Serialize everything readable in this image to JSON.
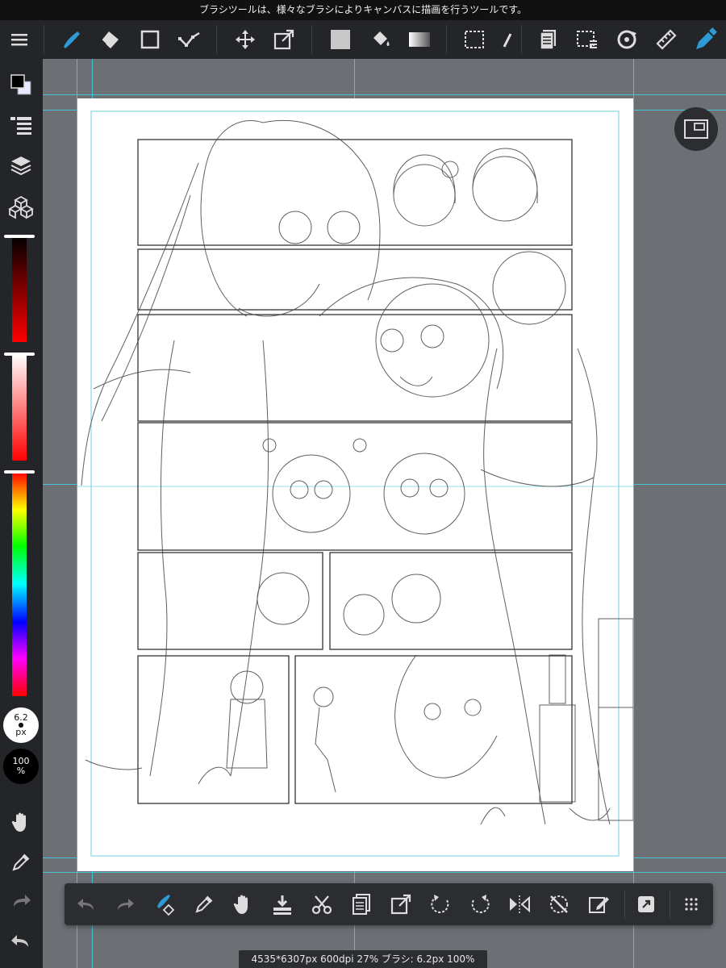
{
  "hint_text": "ブラシツールは、様々なブラシによりキャンバスに描画を行うツールです。",
  "status_text": "4535*6307px 600dpi 27% ブラシ: 6.2px 100%",
  "brush_size": {
    "value": "6.2",
    "unit": "px"
  },
  "brush_opacity": {
    "value": "100",
    "unit": "%"
  },
  "colors": {
    "accent": "#2e9bd6",
    "guide": "#46c1d6",
    "toolbar": "#232528",
    "workspace": "#6c6f74"
  },
  "toolbar_icons": [
    "menu-icon",
    "brush-icon",
    "eraser-icon",
    "rectangle-icon",
    "lasso-line-icon",
    "move-icon",
    "transform-icon",
    "fill-color-icon",
    "bucket-icon",
    "gradient-icon",
    "selection-icon",
    "selection-pen-icon",
    "panel-icon",
    "select-layer-icon",
    "rotate-icon",
    "ruler-icon",
    "active-brush-icon"
  ],
  "sidebar_icons": [
    "color-icon",
    "layer-list-icon",
    "layers-icon",
    "material-icon",
    "hand-icon",
    "eyedropper-icon",
    "redo-icon",
    "undo-icon"
  ],
  "bottom_icons": [
    "undo-icon",
    "redo-icon",
    "brush-clear-icon",
    "eyedropper-icon",
    "hand-icon",
    "import-icon",
    "cut-icon",
    "paste-icon",
    "export-icon",
    "rotate-left-icon",
    "rotate-right-icon",
    "flip-icon",
    "reset-rotation-icon",
    "transform-icon",
    "quick-access-icon",
    "grid-icon"
  ]
}
